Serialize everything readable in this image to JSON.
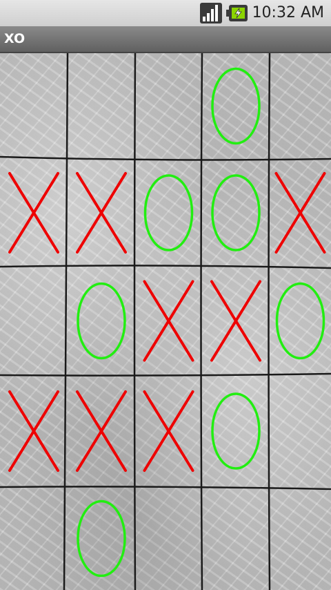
{
  "status_bar": {
    "time": "10:32 AM"
  },
  "app": {
    "title": "XO"
  },
  "colors": {
    "x": "#ee0000",
    "o": "#22ee11",
    "grid": "#1a1a1a"
  },
  "board": {
    "columns": 5,
    "rows": 5,
    "cells": [
      [
        "",
        "",
        "",
        "O",
        ""
      ],
      [
        "X",
        "X",
        "O",
        "O",
        "X"
      ],
      [
        "",
        "O",
        "X",
        "X",
        "O"
      ],
      [
        "X",
        "X",
        "X",
        "O",
        ""
      ],
      [
        "",
        "O",
        "",
        "",
        ""
      ]
    ]
  }
}
